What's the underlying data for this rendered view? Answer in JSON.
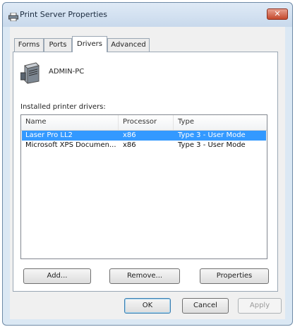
{
  "window": {
    "title": "Print Server Properties",
    "close_label": "✕"
  },
  "tabs": [
    {
      "label": "Forms"
    },
    {
      "label": "Ports"
    },
    {
      "label": "Drivers"
    },
    {
      "label": "Advanced"
    }
  ],
  "server": {
    "name": "ADMIN-PC"
  },
  "drivers": {
    "list_label": "Installed printer drivers:",
    "columns": [
      "Name",
      "Processor",
      "Type"
    ],
    "rows": [
      {
        "name": "Laser Pro LL2",
        "processor": "x86",
        "type": "Type 3 - User Mode",
        "selected": true
      },
      {
        "name": "Microsoft XPS Documen...",
        "processor": "x86",
        "type": "Type 3 - User Mode",
        "selected": false
      }
    ]
  },
  "panel_buttons": {
    "add": "Add...",
    "remove": "Remove...",
    "properties": "Properties"
  },
  "dialog_buttons": {
    "ok": "OK",
    "cancel": "Cancel",
    "apply": "Apply"
  },
  "colors": {
    "selection": "#3399ff",
    "window_frame": "#dbe8f4",
    "close": "#c4482c"
  },
  "icons": {
    "title": "printer-icon",
    "server": "server-icon"
  }
}
